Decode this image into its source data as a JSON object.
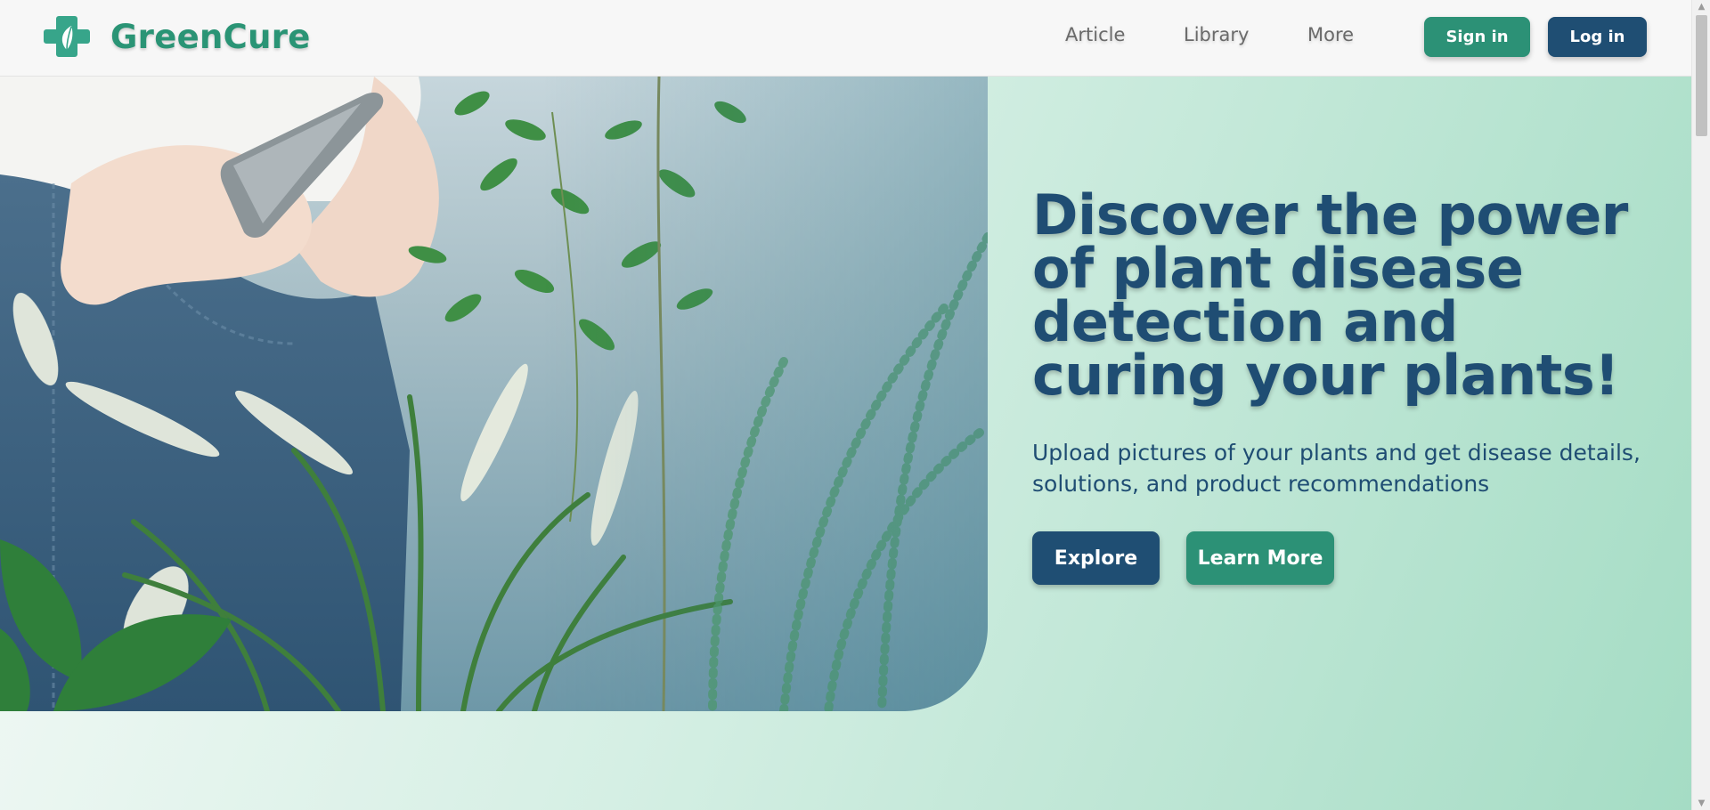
{
  "brand": {
    "name": "GreenCure",
    "icon": "medical-cross-leaf-icon",
    "color": "#2a9475"
  },
  "nav": {
    "links": [
      "Article",
      "Library",
      "More"
    ],
    "sign_in_label": "Sign in",
    "log_in_label": "Log in"
  },
  "hero": {
    "title": "Discover the power of plant disease detection and curing your plants!",
    "subtitle": "Upload pictures of your plants and get disease details, solutions, and product recommendations",
    "explore_label": "Explore",
    "learn_more_label": "Learn More"
  },
  "colors": {
    "primary_green": "#2c9176",
    "primary_blue": "#1f4e73",
    "heading": "#1f4d73"
  }
}
